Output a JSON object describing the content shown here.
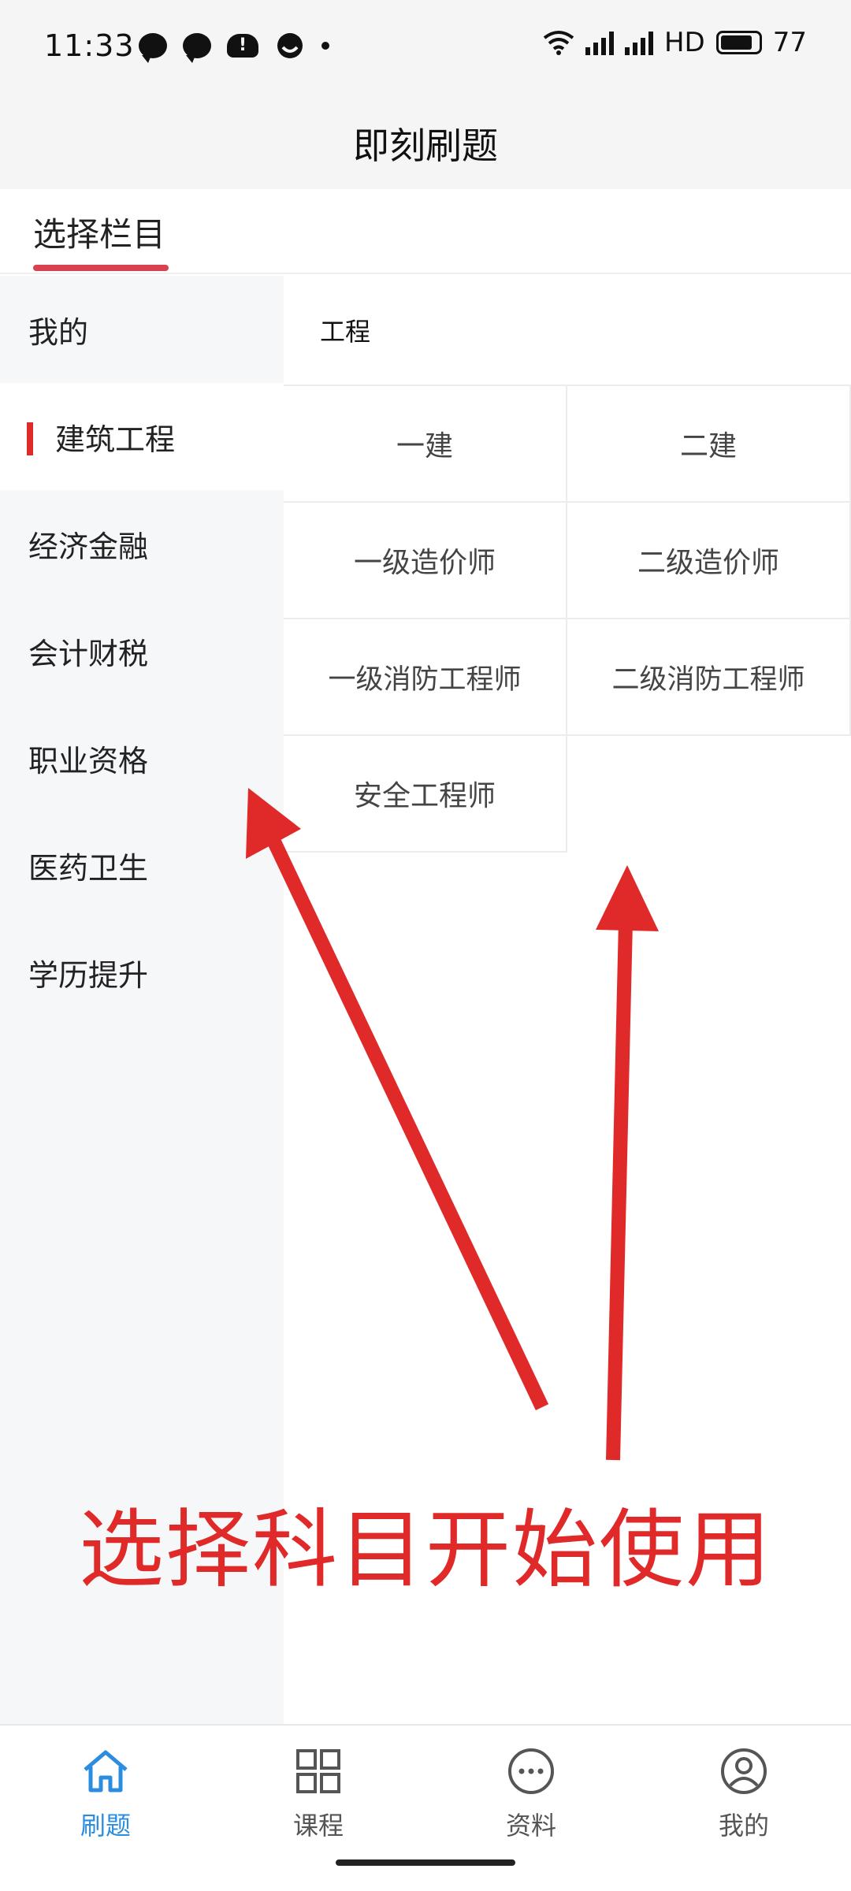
{
  "status_bar": {
    "time": "11:33",
    "network_label": "HD",
    "battery": "77",
    "icons": [
      "message-bubble-icon",
      "chat-bubble-icon",
      "cloud-warning-icon",
      "face-icon",
      "dot-icon",
      "wifi-icon",
      "signal-5g-icon",
      "signal-5g-icon",
      "battery-icon"
    ]
  },
  "header": {
    "title": "即刻刷题"
  },
  "section_tab": {
    "label": "选择栏目"
  },
  "sidebar": {
    "items": [
      {
        "label": "我的"
      },
      {
        "label": "建筑工程"
      },
      {
        "label": "经济金融"
      },
      {
        "label": "会计财税"
      },
      {
        "label": "职业资格"
      },
      {
        "label": "医药卫生"
      },
      {
        "label": "学历提升"
      }
    ],
    "active_index": 1
  },
  "content": {
    "group_title": "工程",
    "subjects": [
      "一建",
      "二建",
      "一级造价师",
      "二级造价师",
      "一级消防工程师",
      "二级消防工程师",
      "安全工程师"
    ]
  },
  "annotation": {
    "text": "选择科目开始使用",
    "color": "#e02a2a"
  },
  "bottom_nav": {
    "items": [
      {
        "label": "刷题",
        "icon": "home-icon"
      },
      {
        "label": "课程",
        "icon": "grid-icon"
      },
      {
        "label": "资料",
        "icon": "more-circle-icon"
      },
      {
        "label": "我的",
        "icon": "user-circle-icon"
      }
    ],
    "active_index": 0,
    "active_color": "#2b8de0"
  }
}
